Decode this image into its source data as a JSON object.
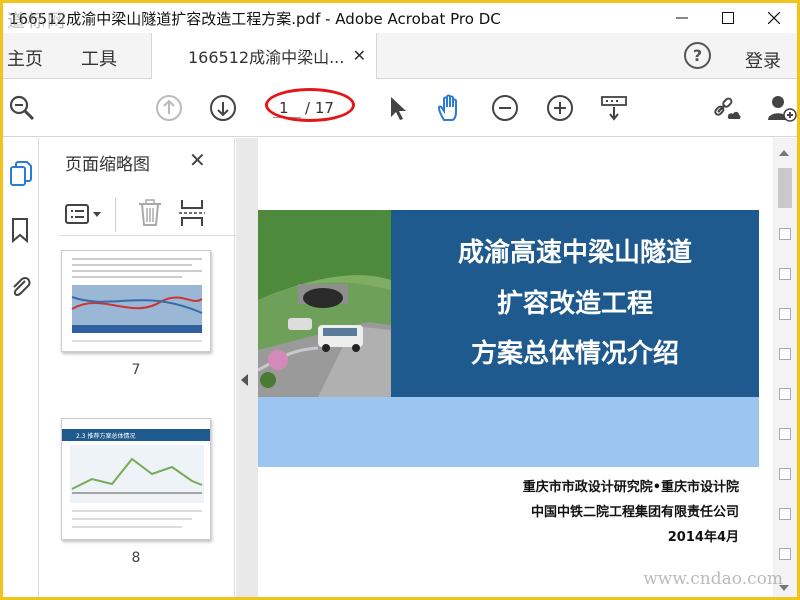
{
  "window": {
    "title": "166512成渝中梁山隧道扩容改造工程方案.pdf - Adobe Acrobat Pro DC",
    "watermark_top": "道标网"
  },
  "menubar": {
    "home": "主页",
    "tools": "工具",
    "doc_tab": "166512成渝中梁山...",
    "login": "登录"
  },
  "toolbar": {
    "current_page": "1",
    "total_pages": "/ 17"
  },
  "thumbnails_panel": {
    "title": "页面缩略图",
    "thumbs": [
      {
        "number": "7"
      },
      {
        "number": "8",
        "heading": "2.3 推荐方案总体情况"
      }
    ]
  },
  "document": {
    "slide_title_lines": [
      "成渝高速中梁山隧道",
      "扩容改造工程",
      "方案总体情况介绍"
    ],
    "org_lines": [
      "重庆市市政设计研究院•重庆市设计院",
      "中国中铁二院工程集团有限责任公司",
      "2014年4月"
    ]
  },
  "watermark_bottom": "www.cndao.com",
  "colors": {
    "frame": "#f2c31c",
    "banner": "#1f5a8e",
    "light_band": "#9cc5ef",
    "hand_tool": "#2b7bd6",
    "annotation": "#e21818"
  }
}
